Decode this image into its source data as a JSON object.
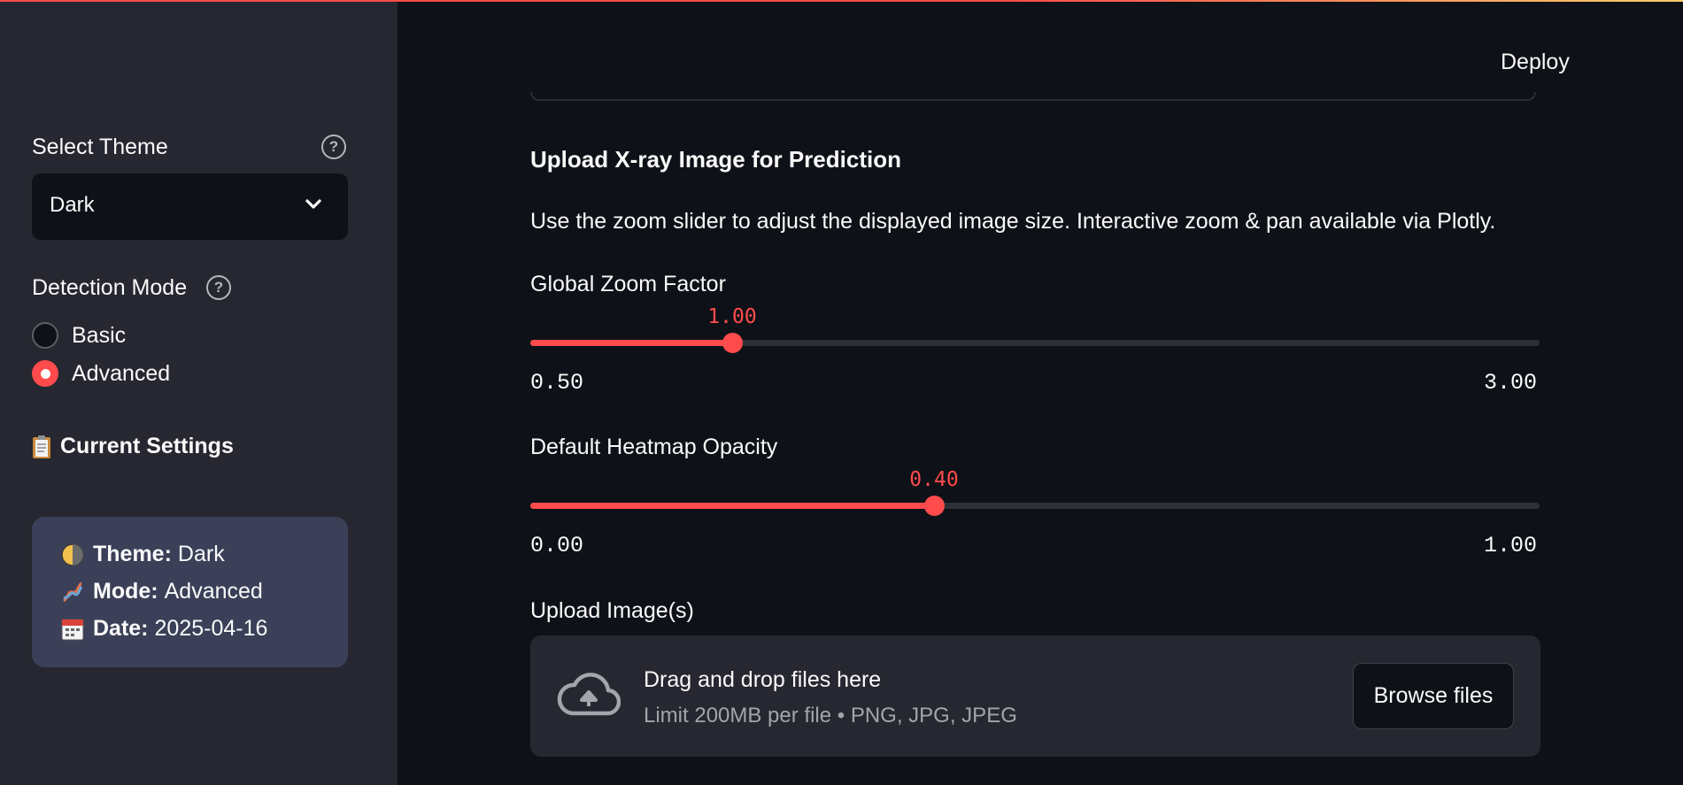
{
  "sidebar": {
    "theme_label": "Select Theme",
    "theme_value": "Dark",
    "mode_label": "Detection Mode",
    "mode_options": [
      "Basic",
      "Advanced"
    ],
    "mode_selected": "Advanced",
    "current_settings_title": "Current Settings",
    "settings": {
      "theme_key": "Theme:",
      "theme_val": "Dark",
      "mode_key": "Mode:",
      "mode_val": "Advanced",
      "date_key": "Date:",
      "date_val": "2025-04-16"
    }
  },
  "header": {
    "deploy_label": "Deploy"
  },
  "main": {
    "upload_heading": "Upload X-ray Image for Prediction",
    "description": "Use the zoom slider to adjust the displayed image size. Interactive zoom & pan available via Plotly.",
    "zoom_slider": {
      "label": "Global Zoom Factor",
      "value": 1.0,
      "value_text": "1.00",
      "min": 0.5,
      "max": 3.0,
      "min_text": "0.50",
      "max_text": "3.00"
    },
    "opacity_slider": {
      "label": "Default Heatmap Opacity",
      "value": 0.4,
      "value_text": "0.40",
      "min": 0.0,
      "max": 1.0,
      "min_text": "0.00",
      "max_text": "1.00"
    },
    "uploader": {
      "label": "Upload Image(s)",
      "title": "Drag and drop files here",
      "subtitle": "Limit 200MB per file • PNG, JPG, JPEG",
      "button": "Browse files"
    }
  },
  "colors": {
    "accent": "#ff4b4b",
    "background": "#0e1117",
    "sidebar": "#262730",
    "settings_box": "#3b4058"
  },
  "icons": [
    "help-icon",
    "chevron-down-icon",
    "clipboard-icon",
    "moon-icon",
    "dna-icon",
    "calendar-icon",
    "cloud-upload-icon"
  ]
}
